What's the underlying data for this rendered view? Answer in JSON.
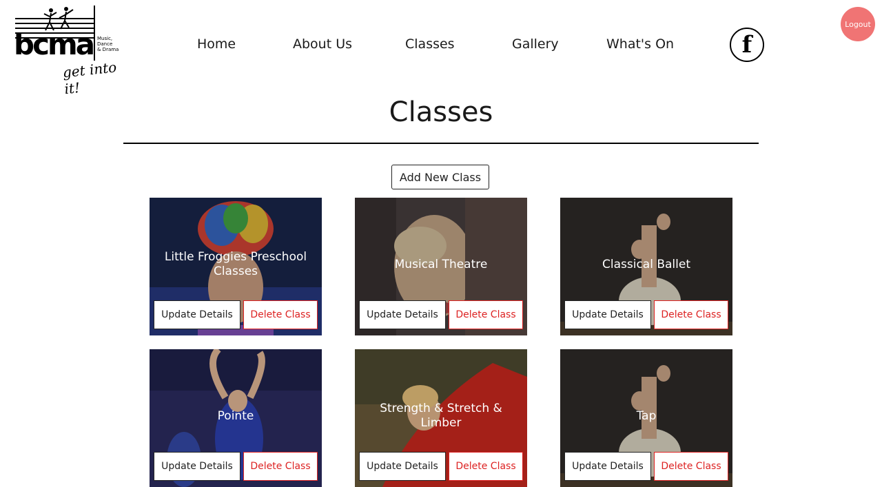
{
  "logo": {
    "word": "bcma",
    "sub": [
      "Music,",
      "Dance",
      "& Drama"
    ],
    "tagline": "get into it!"
  },
  "nav": {
    "items": [
      {
        "label": "Home"
      },
      {
        "label": "About Us"
      },
      {
        "label": "Classes"
      },
      {
        "label": "Gallery"
      },
      {
        "label": "What's On"
      }
    ],
    "facebook_glyph": "f",
    "logout_label": "Logout"
  },
  "page": {
    "title": "Classes",
    "add_button_label": "Add New Class"
  },
  "classes": [
    {
      "title": "Little Froggies Preschool Classes",
      "update_label": "Update Details",
      "delete_label": "Delete Class"
    },
    {
      "title": "Musical Theatre",
      "update_label": "Update Details",
      "delete_label": "Delete Class"
    },
    {
      "title": "Classical Ballet",
      "update_label": "Update Details",
      "delete_label": "Delete Class"
    },
    {
      "title": "Pointe",
      "update_label": "Update Details",
      "delete_label": "Delete Class"
    },
    {
      "title": "Strength & Stretch & Limber",
      "update_label": "Update Details",
      "delete_label": "Delete Class"
    },
    {
      "title": "Tap",
      "update_label": "Update Details",
      "delete_label": "Delete Class"
    }
  ],
  "colors": {
    "logout_bg": "#f07474",
    "delete_red": "#dd2222",
    "accent_text": "#1a1a1a"
  }
}
